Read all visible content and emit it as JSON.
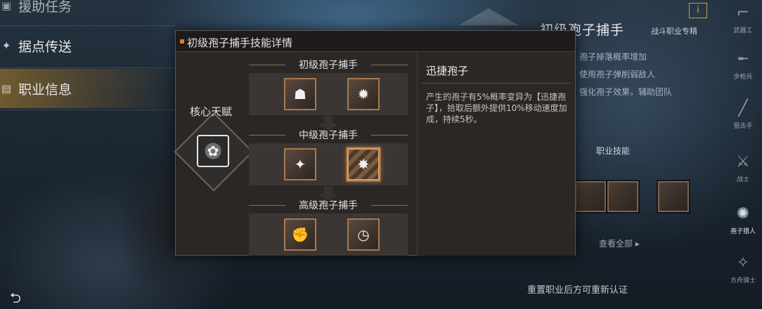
{
  "left_menu": {
    "items": [
      {
        "label": "援助任务",
        "icon": "task-icon"
      },
      {
        "label": "据点传送",
        "icon": "teleport-icon"
      },
      {
        "label": "职业信息",
        "icon": "profile-icon"
      }
    ],
    "back_icon": "back-arrow-icon"
  },
  "right_panel": {
    "title": "初级孢子捕手",
    "badge": "战斗职业专精",
    "info_icon": "i",
    "lines": [
      "孢子掉落概率增加",
      "使用孢子弹削弱敌人",
      "强化孢子效果，辅助团队"
    ],
    "skills_title": "职业技能",
    "view_all": "查看全部 ▸",
    "bottom_text": "重置职业后方可重新认证"
  },
  "side_bar": {
    "items": [
      {
        "label": "武器工",
        "icon": "gun-icon"
      },
      {
        "label": "步枪兵",
        "icon": "rifle-icon"
      },
      {
        "label": "狙击手",
        "icon": "sniper-icon"
      },
      {
        "label": "战士",
        "icon": "blade-icon"
      },
      {
        "label": "孢子猎人",
        "icon": "spore-icon"
      },
      {
        "label": "方舟骑士",
        "icon": "knight-icon"
      }
    ],
    "active_index": 4
  },
  "dialog": {
    "title": "初级孢子捕手技能详情",
    "core_label": "核心天赋",
    "tiers": [
      {
        "title": "初级孢子捕手"
      },
      {
        "title": "中级孢子捕手"
      },
      {
        "title": "高级孢子捕手"
      }
    ],
    "detail": {
      "title": "迅捷孢子",
      "description": "产生的孢子有5%概率变异为【迅捷孢子】，拾取后额外提供10%移动速度加成，持续5秒。"
    }
  },
  "colors": {
    "accent": "#e07a2a",
    "dialog_bg": "#2b2725",
    "skill_border": "#a87a50",
    "menu_active": "#b48228"
  }
}
